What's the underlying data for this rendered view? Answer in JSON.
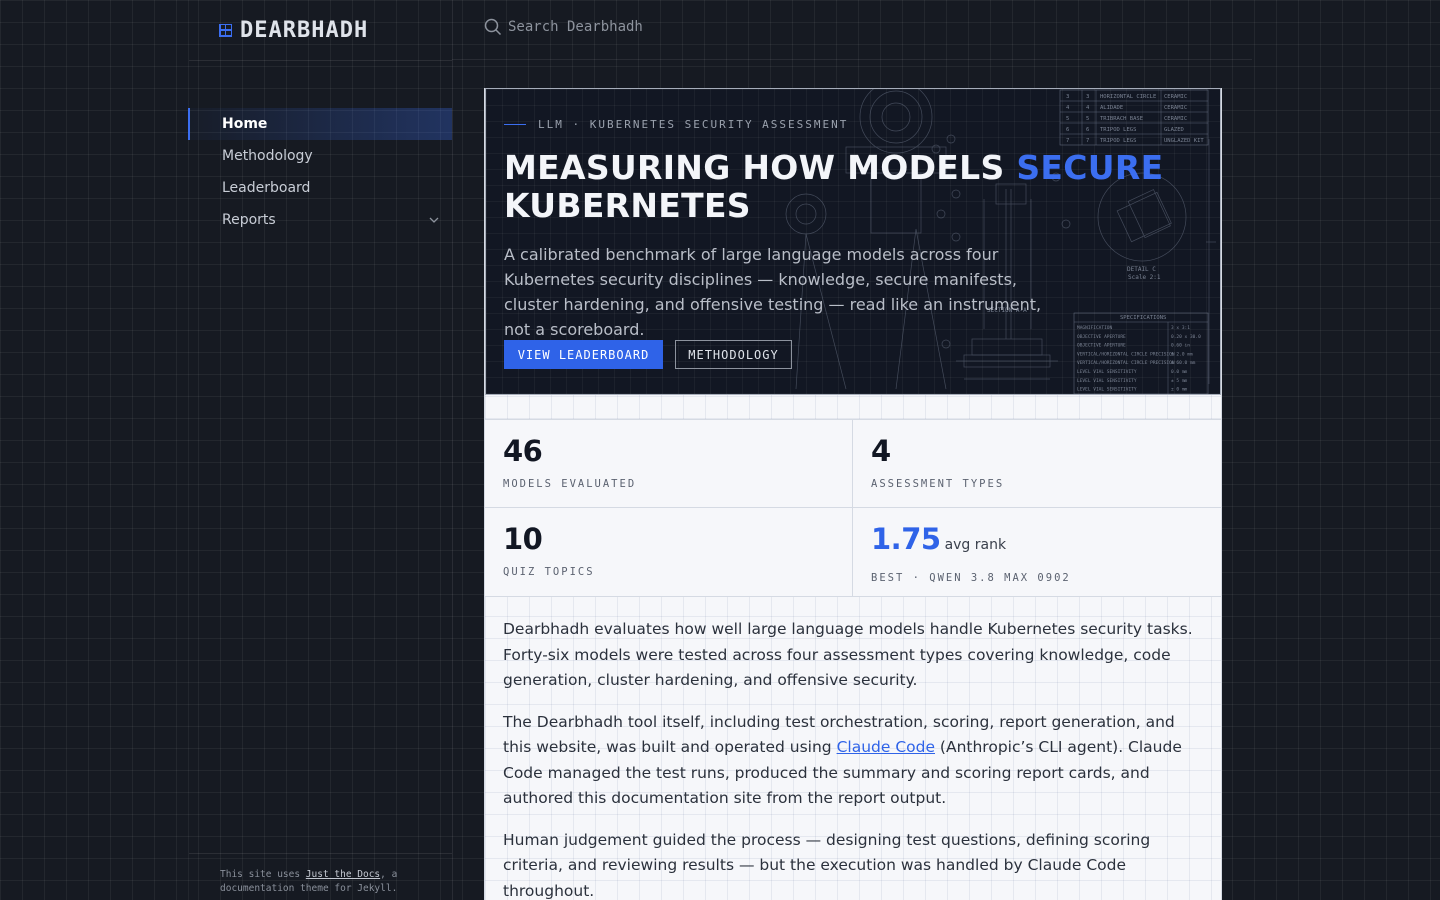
{
  "brand": {
    "name": "DEARBHADH"
  },
  "search": {
    "placeholder": "Search Dearbhadh"
  },
  "sidebar": {
    "items": [
      {
        "label": "Home",
        "active": true
      },
      {
        "label": "Methodology"
      },
      {
        "label": "Leaderboard"
      },
      {
        "label": "Reports",
        "expandable": true
      }
    ],
    "footer": {
      "prefix": "This site uses ",
      "link": "Just the Docs",
      "suffix": ", a documentation theme for Jekyll."
    }
  },
  "hero": {
    "eyebrow": "LLM · KUBERNETES SECURITY ASSESSMENT",
    "title_before": "MEASURING HOW MODELS ",
    "title_accent": "SECURE",
    "title_after": " KUBERNETES",
    "subtitle": "A calibrated benchmark of large language models across four Kubernetes security disciplines — knowledge, secure manifests, cluster hardening, and offensive testing — read like an instrument, not a scoreboard.",
    "primary_button": "VIEW LEADERBOARD",
    "secondary_button": "METHODOLOGY",
    "blueprint": {
      "table_rows": [
        [
          "3",
          "3",
          "HORIZONTAL CIRCLE",
          "CERAMIC"
        ],
        [
          "4",
          "4",
          "ALIDADE",
          "CERAMIC"
        ],
        [
          "5",
          "5",
          "TRIBRACH BASE",
          "CERAMIC"
        ],
        [
          "6",
          "6",
          "TRIPOD LEGS",
          "GLAZED"
        ],
        [
          "7",
          "7",
          "TRIPOD LEGS",
          "UNGLAZED KIT"
        ]
      ],
      "detail_label": "DETAIL C",
      "detail_scale": "Scale 2:1",
      "section_label": "SECTION A-A",
      "spec_title": "SPECIFICATIONS",
      "spec_rows": [
        [
          "MAGNIFICATION",
          "3 x 3:1"
        ],
        [
          "OBJECTIVE APERTURE",
          "0.20 x 30.0"
        ],
        [
          "OBJECTIVE APERTURE",
          "0.60 in"
        ],
        [
          "VERTICAL/HORIZONTAL CIRCLE PRECISION",
          "± 2.0 mm"
        ],
        [
          "VERTICAL/HORIZONTAL CIRCLE PRECISION",
          "± 60.0 mm"
        ],
        [
          "LEVEL VIAL SENSITIVITY",
          "0.0 mm"
        ],
        [
          "LEVEL VIAL SENSITIVITY",
          "± 5 mm"
        ],
        [
          "LEVEL VIAL SENSITIVITY",
          "± 0 mm"
        ]
      ]
    }
  },
  "stats": [
    {
      "value": "46",
      "label": "MODELS EVALUATED"
    },
    {
      "value": "4",
      "label": "ASSESSMENT TYPES"
    },
    {
      "value": "10",
      "label": "QUIZ TOPICS"
    },
    {
      "value": "1.75",
      "unit": "avg rank",
      "label": "BEST · QWEN 3.8 MAX 0902",
      "accent_color": "#2f63e8"
    }
  ],
  "content": {
    "p1": "Dearbhadh evaluates how well large language models handle Kubernetes security tasks. Forty-six models were tested across four assessment types covering knowledge, code generation, cluster hardening, and offensive security.",
    "p2_before": "The Dearbhadh tool itself, including test orchestration, scoring, report generation, and this website, was built and operated using ",
    "p2_link": "Claude Code",
    "p2_after": " (Anthropic’s CLI agent). Claude Code managed the test runs, produced the summary and scoring report cards, and authored this documentation site from the report output.",
    "p3": "Human judgement guided the process — designing test questions, defining scoring criteria, and reviewing results — but the execution was handled by Claude Code throughout."
  },
  "colors": {
    "accent": "#3b6ef0",
    "page_bg": "#161a22",
    "content_bg": "#f6f7fa",
    "hero_bg": "#121723"
  },
  "icons": {
    "brand": "grid-square-icon",
    "search": "search-icon",
    "expand": "chevron-down-icon"
  }
}
